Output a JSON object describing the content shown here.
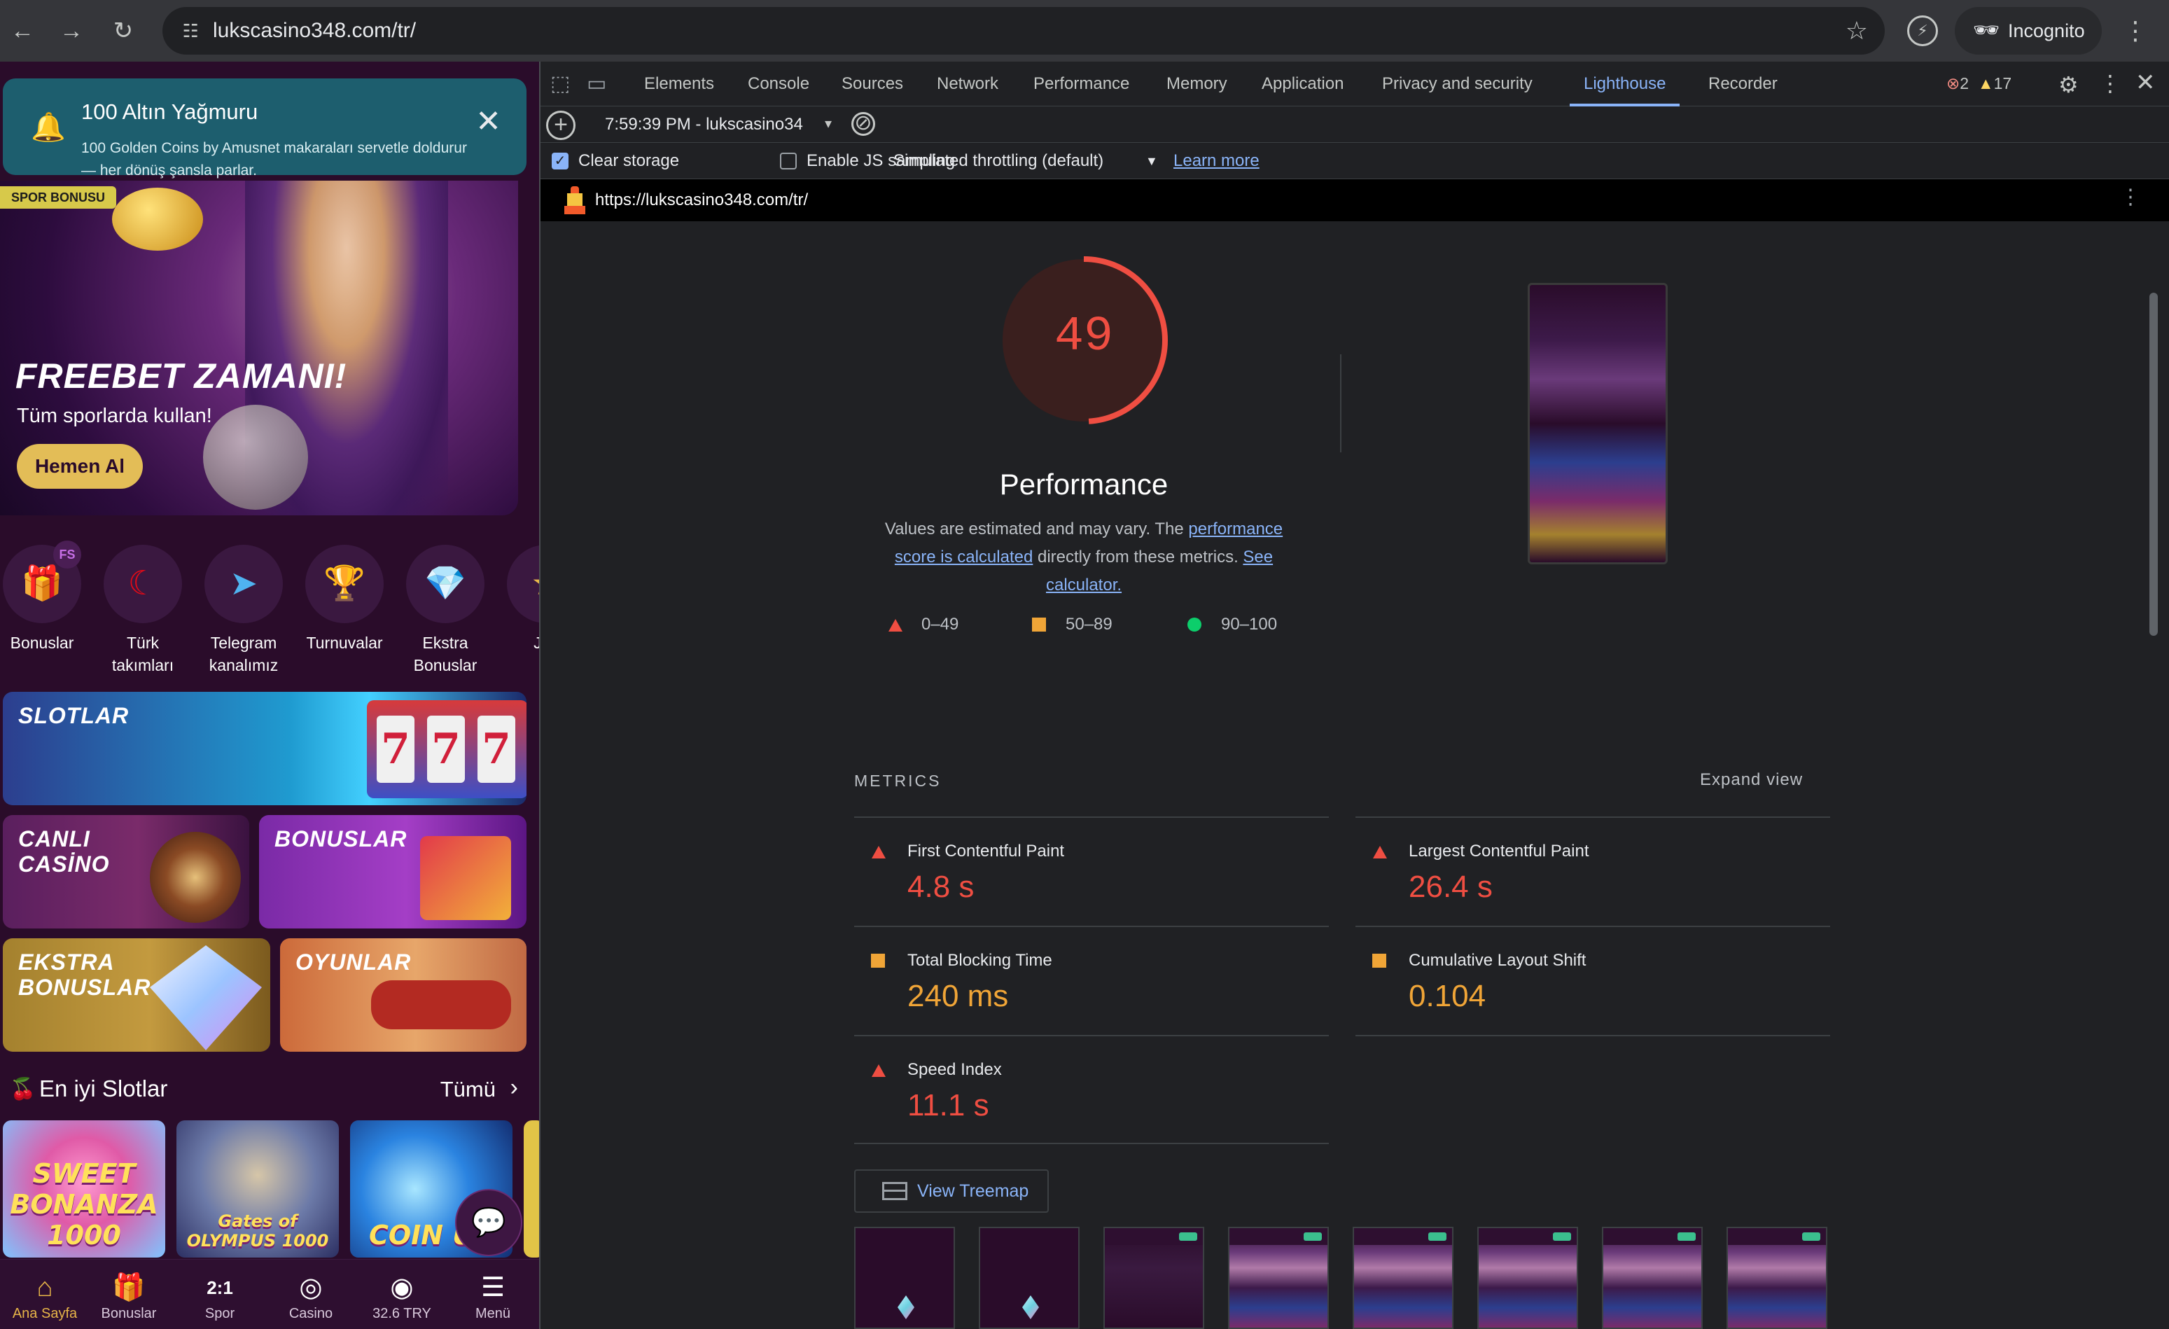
{
  "browser": {
    "url": "lukscasino348.com/tr/",
    "incognito_label": "Incognito",
    "icons": [
      "back-icon",
      "forward-icon",
      "reload-icon",
      "site-settings-icon",
      "bookmark-star-icon",
      "extension-icon",
      "incognito-icon",
      "menu-kebab-icon"
    ]
  },
  "site": {
    "toast": {
      "title": "100 Altın Yağmuru",
      "text": "100 Golden Coins by Amusnet makaraları servetle doldurur — her dönüş şansla parlar."
    },
    "banner": {
      "tag": "SPOR BONUSU",
      "title": "FREEBET ZAMANI!",
      "subtitle": "Tüm sporlarda kullan!",
      "button": "Hemen Al"
    },
    "categories": [
      {
        "label": "Bonuslar",
        "badge": "FS",
        "icon": "gift-icon"
      },
      {
        "label": "Türk takımları",
        "badge": "",
        "icon": "turkey-flag-icon"
      },
      {
        "label": "Telegram kanalımız",
        "badge": "",
        "icon": "telegram-icon"
      },
      {
        "label": "Turnuvalar",
        "badge": "",
        "icon": "trophy-icon"
      },
      {
        "label": "Ekstra Bonuslar",
        "badge": "",
        "icon": "diamond-icon"
      },
      {
        "label": "Jac",
        "badge": "",
        "icon": "jackpot-icon"
      }
    ],
    "tiles": {
      "slot": "SLOTLAR",
      "canli_line1": "CANLI",
      "canli_line2": "CASİNO",
      "bonus": "BONUSLAR",
      "ekstra_line1": "EKSTRA",
      "ekstra_line2": "BONUSLAR",
      "oyun": "OYUNLAR"
    },
    "section": {
      "title": "En iyi Slotlar",
      "all": "Tümü"
    },
    "games": [
      "SWEET BONANZA 1000",
      "Gates of OLYMPUS 1000",
      "COIN UP"
    ],
    "tabbar": [
      {
        "label": "Ana Sayfa",
        "icon": "home-icon",
        "active": true
      },
      {
        "label": "Bonuslar",
        "icon": "gift-icon",
        "active": false
      },
      {
        "label": "Spor",
        "icon": "sport-score-icon",
        "active": false
      },
      {
        "label": "Casino",
        "icon": "casino-chip-icon",
        "active": false
      },
      {
        "label": "32.6 TRY",
        "icon": "account-icon",
        "active": false
      },
      {
        "label": "Menü",
        "icon": "menu-icon",
        "active": false
      }
    ]
  },
  "devtools": {
    "tabs": [
      "Elements",
      "Console",
      "Sources",
      "Network",
      "Performance",
      "Memory",
      "Application",
      "Privacy and security",
      "Lighthouse",
      "Recorder"
    ],
    "active_tab": "Lighthouse",
    "errors": "2",
    "warnings": "17",
    "report_select": "7:59:39 PM - lukscasino34",
    "clear_storage": "Clear storage",
    "js_sampling": "Enable JS sampling",
    "throttling": "Simulated throttling (default)",
    "learn_more": "Learn more",
    "report_url": "https://lukscasino348.com/tr/",
    "score": "49",
    "score_value": 49,
    "category": "Performance",
    "desc_1": "Values are estimated and may vary. The ",
    "desc_link1": "performance score is calculated",
    "desc_2": " directly from these metrics. ",
    "desc_link2": "See calculator.",
    "legend": [
      "0–49",
      "50–89",
      "90–100"
    ],
    "metrics_title": "METRICS",
    "expand": "Expand view",
    "metrics": [
      {
        "name": "First Contentful Paint",
        "value": "4.8 s",
        "rating": "fail"
      },
      {
        "name": "Largest Contentful Paint",
        "value": "26.4 s",
        "rating": "fail"
      },
      {
        "name": "Total Blocking Time",
        "value": "240 ms",
        "rating": "average"
      },
      {
        "name": "Cumulative Layout Shift",
        "value": "0.104",
        "rating": "average"
      },
      {
        "name": "Speed Index",
        "value": "11.1 s",
        "rating": "fail"
      }
    ],
    "treemap": "View Treemap",
    "colors": {
      "fail": "#ef4e42",
      "average": "#f0a537",
      "pass": "#0cce6b",
      "accent": "#8ab4f8"
    }
  }
}
